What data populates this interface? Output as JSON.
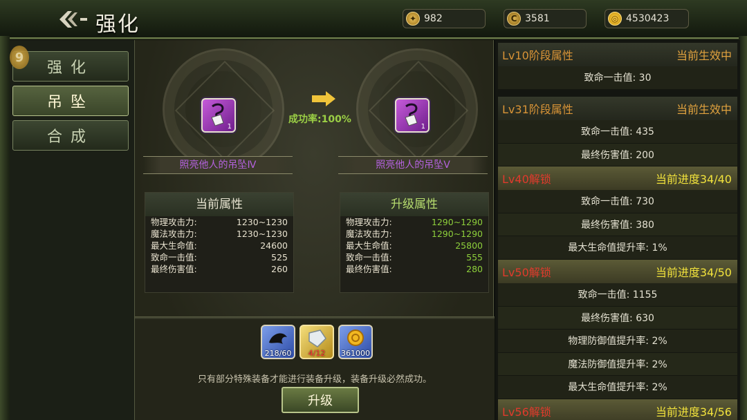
{
  "header": {
    "title": "强化",
    "currencies": [
      {
        "icon": "gold-gem-coin-icon",
        "value": "982"
      },
      {
        "icon": "c-coin-icon",
        "value": "3581"
      },
      {
        "icon": "gold-coin-icon",
        "value": "4530423"
      }
    ]
  },
  "nav": {
    "badge": "9",
    "items": [
      {
        "label": "强化",
        "active": false
      },
      {
        "label": "吊坠",
        "active": true
      },
      {
        "label": "合成",
        "active": false
      }
    ]
  },
  "upgrade": {
    "current_item": {
      "name": "照亮他人的吊坠Ⅳ",
      "count": "1"
    },
    "next_item": {
      "name": "照亮他人的吊坠Ⅴ",
      "count": "1"
    },
    "success_rate": "成功率:100%",
    "current_attrs": {
      "title": "当前属性",
      "rows": [
        {
          "label": "物理攻击力:",
          "value": "1230~1230"
        },
        {
          "label": "魔法攻击力:",
          "value": "1230~1230"
        },
        {
          "label": "最大生命值:",
          "value": "24600"
        },
        {
          "label": "致命一击值:",
          "value": "525"
        },
        {
          "label": "最终伤害值:",
          "value": "260"
        }
      ]
    },
    "next_attrs": {
      "title": "升级属性",
      "rows": [
        {
          "label": "物理攻击力:",
          "value": "1290~1290"
        },
        {
          "label": "魔法攻击力:",
          "value": "1290~1290"
        },
        {
          "label": "最大生命值:",
          "value": "25800"
        },
        {
          "label": "致命一击值:",
          "value": "555"
        },
        {
          "label": "最终伤害值:",
          "value": "280"
        }
      ]
    },
    "materials": [
      {
        "icon": "dark-beast-material-icon",
        "count": "218/60"
      },
      {
        "icon": "crystal-material-icon",
        "count": "4/12"
      },
      {
        "icon": "gold-coin-material-icon",
        "count": "361000"
      }
    ],
    "notice": "只有部分特殊装备才能进行装备升级，装备升级必然成功。",
    "button_label": "升级"
  },
  "stages": [
    {
      "level": "Lv10阶段属性",
      "status": "当前生效中",
      "locked": false,
      "rows": [
        "致命一击值: 30"
      ]
    },
    {
      "level": "Lv31阶段属性",
      "status": "当前生效中",
      "locked": false,
      "rows": [
        "致命一击值: 435",
        "最终伤害值: 200"
      ]
    },
    {
      "level": "Lv40解锁",
      "status": "当前进度34/40",
      "locked": true,
      "rows": [
        "致命一击值: 730",
        "最终伤害值: 380",
        "最大生命值提升率: 1%"
      ]
    },
    {
      "level": "Lv50解锁",
      "status": "当前进度34/50",
      "locked": true,
      "rows": [
        "致命一击值: 1155",
        "最终伤害值: 630",
        "物理防御值提升率: 2%",
        "魔法防御值提升率: 2%",
        "最大生命值提升率: 2%"
      ]
    },
    {
      "level": "Lv56解锁",
      "status": "当前进度34/56",
      "locked": true,
      "rows": []
    }
  ]
}
